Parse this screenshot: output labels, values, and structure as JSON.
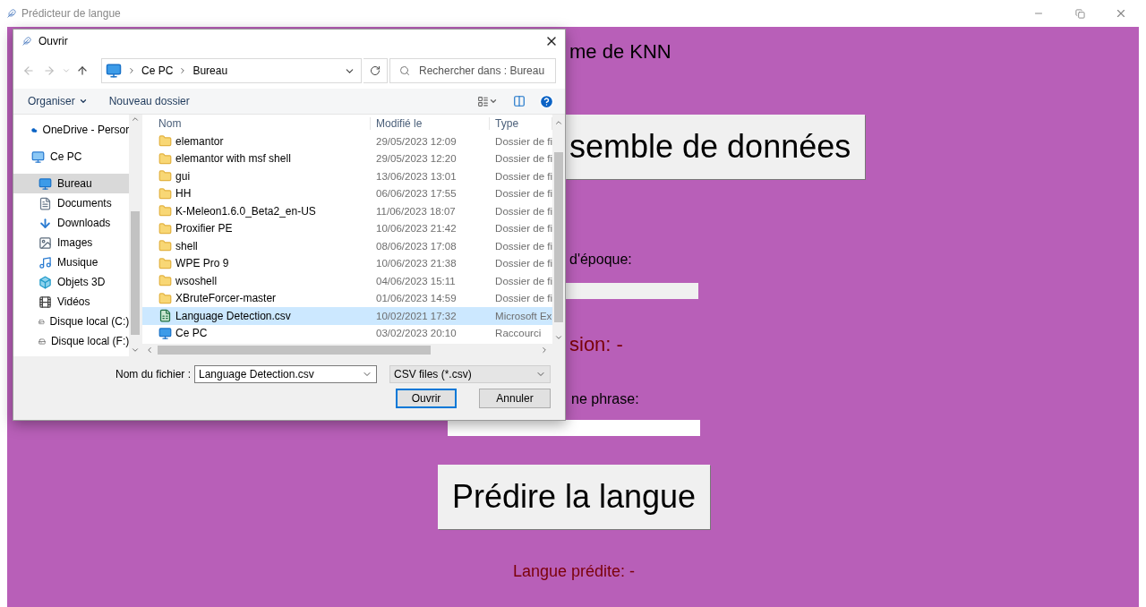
{
  "window": {
    "title": "Prédicteur de langue"
  },
  "app": {
    "heading": "me de KNN",
    "load_button": "semble de données",
    "epoch_label": "d'époque:",
    "precision": "sion: -",
    "phrase_label": "ne phrase:",
    "predict_button": "Prédire la langue",
    "prediction": "Langue prédite: -"
  },
  "dialog": {
    "title": "Ouvrir",
    "breadcrumb": [
      "Ce PC",
      "Bureau"
    ],
    "search": {
      "placeholder": "Rechercher dans : Bureau"
    },
    "toolbar": [
      "Organiser",
      "Nouveau dossier"
    ],
    "nav": [
      {
        "label": "OneDrive - Persor",
        "kind": "cloud",
        "selected": false
      },
      {
        "label": "Ce PC",
        "kind": "pc",
        "selected": false,
        "children": [
          {
            "label": "Bureau",
            "kind": "desktop",
            "selected": true
          },
          {
            "label": "Documents",
            "kind": "documents",
            "selected": false
          },
          {
            "label": "Downloads",
            "kind": "downloads",
            "selected": false
          },
          {
            "label": "Images",
            "kind": "images",
            "selected": false
          },
          {
            "label": "Musique",
            "kind": "music",
            "selected": false
          },
          {
            "label": "Objets 3D",
            "kind": "objects",
            "selected": false
          },
          {
            "label": "Vidéos",
            "kind": "videos",
            "selected": false
          },
          {
            "label": "Disque local (C:)",
            "kind": "drive",
            "selected": false
          },
          {
            "label": "Disque local (F:)",
            "kind": "drive",
            "selected": false
          }
        ]
      }
    ],
    "columns": [
      "Nom",
      "Modifié le",
      "Type"
    ],
    "files": [
      {
        "name": "elemantor",
        "modified": "29/05/2023 12:09",
        "type": "Dossier de fi",
        "kind": "folder",
        "selected": false
      },
      {
        "name": "elemantor with msf shell",
        "modified": "29/05/2023 12:20",
        "type": "Dossier de fi",
        "kind": "folder",
        "selected": false
      },
      {
        "name": "gui",
        "modified": "13/06/2023 13:01",
        "type": "Dossier de fi",
        "kind": "folder",
        "selected": false
      },
      {
        "name": "HH",
        "modified": "06/06/2023 17:55",
        "type": "Dossier de fi",
        "kind": "folder",
        "selected": false
      },
      {
        "name": "K-Meleon1.6.0_Beta2_en-US",
        "modified": "11/06/2023 18:07",
        "type": "Dossier de fi",
        "kind": "folder",
        "selected": false
      },
      {
        "name": "Proxifier PE",
        "modified": "10/06/2023 21:42",
        "type": "Dossier de fi",
        "kind": "folder",
        "selected": false
      },
      {
        "name": "shell",
        "modified": "08/06/2023 17:08",
        "type": "Dossier de fi",
        "kind": "folder",
        "selected": false
      },
      {
        "name": "WPE Pro 9",
        "modified": "10/06/2023 21:38",
        "type": "Dossier de fi",
        "kind": "folder",
        "selected": false
      },
      {
        "name": "wsoshell",
        "modified": "04/06/2023 15:11",
        "type": "Dossier de fi",
        "kind": "folder",
        "selected": false
      },
      {
        "name": "XBruteForcer-master",
        "modified": "01/06/2023 14:59",
        "type": "Dossier de fi",
        "kind": "folder",
        "selected": false
      },
      {
        "name": "Language Detection.csv",
        "modified": "10/02/2021 17:32",
        "type": "Microsoft Ex",
        "kind": "csv",
        "selected": true
      },
      {
        "name": "Ce PC",
        "modified": "03/02/2023 20:10",
        "type": "Raccourci",
        "kind": "shortcut",
        "selected": false
      }
    ],
    "filename_label": "Nom du fichier :",
    "filename": "Language Detection.csv",
    "filter": "CSV files (*.csv)",
    "buttons": [
      "Ouvrir",
      "Annuler"
    ]
  }
}
